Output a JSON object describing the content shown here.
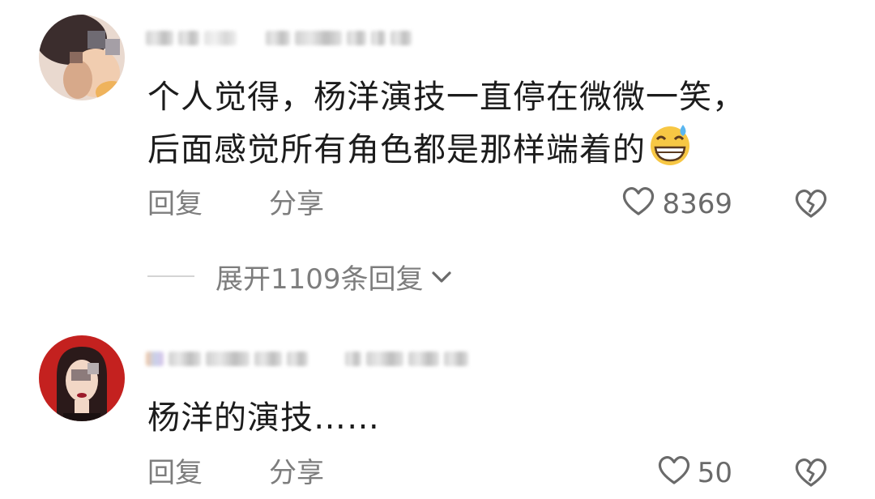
{
  "comments": [
    {
      "text_lines": [
        "个人觉得，杨洋演技一直停在微微一笑，",
        "后面感觉所有角色都是那样端着的"
      ],
      "emoji": "grinning-sweat-emoji",
      "reply_label": "回复",
      "share_label": "分享",
      "likes": "8369"
    },
    {
      "text_lines": [
        "杨洋的演技……"
      ],
      "reply_label": "回复",
      "share_label": "分享",
      "likes": "50"
    }
  ],
  "expand_replies": {
    "label": "展开1109条回复"
  },
  "icons": {
    "like": "heart-outline-icon",
    "dislike": "broken-heart-icon",
    "expand": "chevron-down-icon"
  },
  "colors": {
    "text": "#1c1c1c",
    "secondary": "#7d7d7d",
    "background": "#ffffff"
  }
}
